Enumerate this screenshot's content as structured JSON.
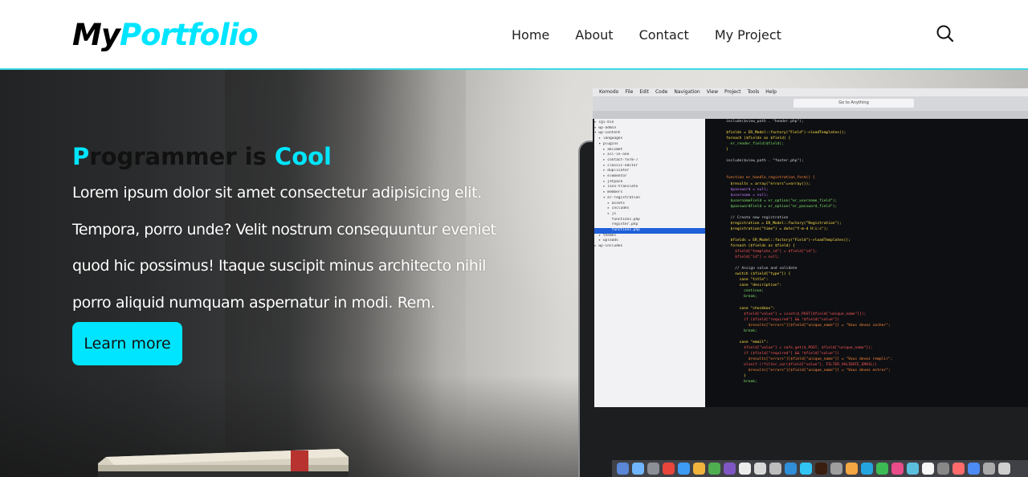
{
  "brand": {
    "part1": "My",
    "part2": "Portfolio"
  },
  "nav": {
    "home": "Home",
    "about": "About",
    "contact": "Contact",
    "project": "My Project",
    "search_icon": "search-icon"
  },
  "hero": {
    "title_p": "P",
    "title_rest": "rogrammer is ",
    "title_cool": "Cool",
    "lines": [
      "Lorem ipsum dolor sit amet consectetur adipisicing elit.",
      "Tempora, porro unde? Velit nostrum consequuntur eveniet",
      "quod hic possimus! Itaque suscipit minus architecto nihil",
      "porro aliquid numquam aspernatur in modi. Rem."
    ],
    "button": "Learn more"
  },
  "colors": {
    "accent": "#00e5ff",
    "nav_border": "#39d9e6"
  }
}
